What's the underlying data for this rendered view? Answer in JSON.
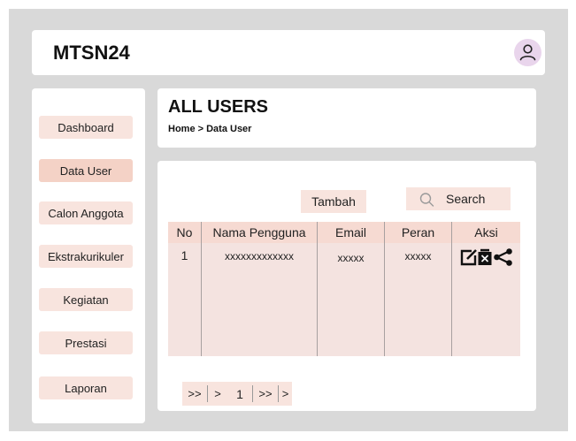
{
  "header": {
    "app_title": "MTSN24",
    "avatar_icon": "user-icon"
  },
  "sidebar": {
    "items": [
      {
        "label": "Dashboard"
      },
      {
        "label": "Data User",
        "active": true
      },
      {
        "label": "Calon Anggota"
      },
      {
        "label": "Ekstrakurikuler"
      },
      {
        "label": "Kegiatan"
      },
      {
        "label": "Prestasi"
      },
      {
        "label": "Laporan"
      }
    ]
  },
  "page": {
    "title": "ALL USERS",
    "breadcrumb": "Home > Data User"
  },
  "toolbar": {
    "add_label": "Tambah",
    "search_label": "Search",
    "search_icon": "search-icon"
  },
  "table": {
    "headers": [
      "No",
      "Nama Pengguna",
      "Email",
      "Peran",
      "Aksi"
    ],
    "rows": [
      {
        "no": "1",
        "name": "xxxxxxxxxxxxx",
        "email": "xxxxx",
        "role": "xxxxx",
        "actions": [
          "edit-icon",
          "delete-icon",
          "share-icon"
        ]
      }
    ]
  },
  "pagination": {
    "items": [
      ">>",
      ">",
      "1",
      ">>",
      ">"
    ]
  },
  "colors": {
    "background": "#d9d9d9",
    "accent": "#f8e4de",
    "accent_active": "#f4d2c6",
    "avatar": "#e9d5ec"
  }
}
